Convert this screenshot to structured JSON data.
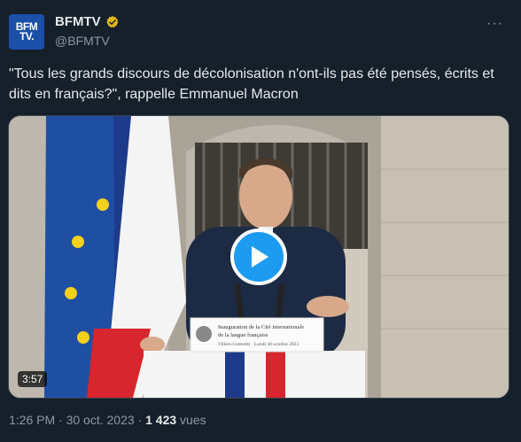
{
  "author": {
    "avatar_text_line1": "BFM",
    "avatar_text_line2": "TV.",
    "display_name": "BFMTV",
    "handle": "@BFMTV",
    "verified_badge_color": "#e2b719"
  },
  "tweet": {
    "text": "\"Tous les grands discours de décolonisation n'ont-ils pas été pensés, écrits et dits en français?\", rappelle Emmanuel Macron"
  },
  "media": {
    "duration": "3:57",
    "lectern_sign_line1": "Inauguration de la Cité internationale",
    "lectern_sign_line2": "de la langue française",
    "lectern_sign_line3": "Villers-Cotterêts · Lundi 30 octobre 2023"
  },
  "meta": {
    "time": "1:26 PM",
    "separator1": " · ",
    "date": "30 oct. 2023",
    "separator2": " · ",
    "views_count": "1 423",
    "views_label": " vues"
  },
  "colors": {
    "background": "#15202b",
    "accent": "#1d9bf0",
    "muted": "#8b98a5",
    "text": "#e7e9ea"
  }
}
